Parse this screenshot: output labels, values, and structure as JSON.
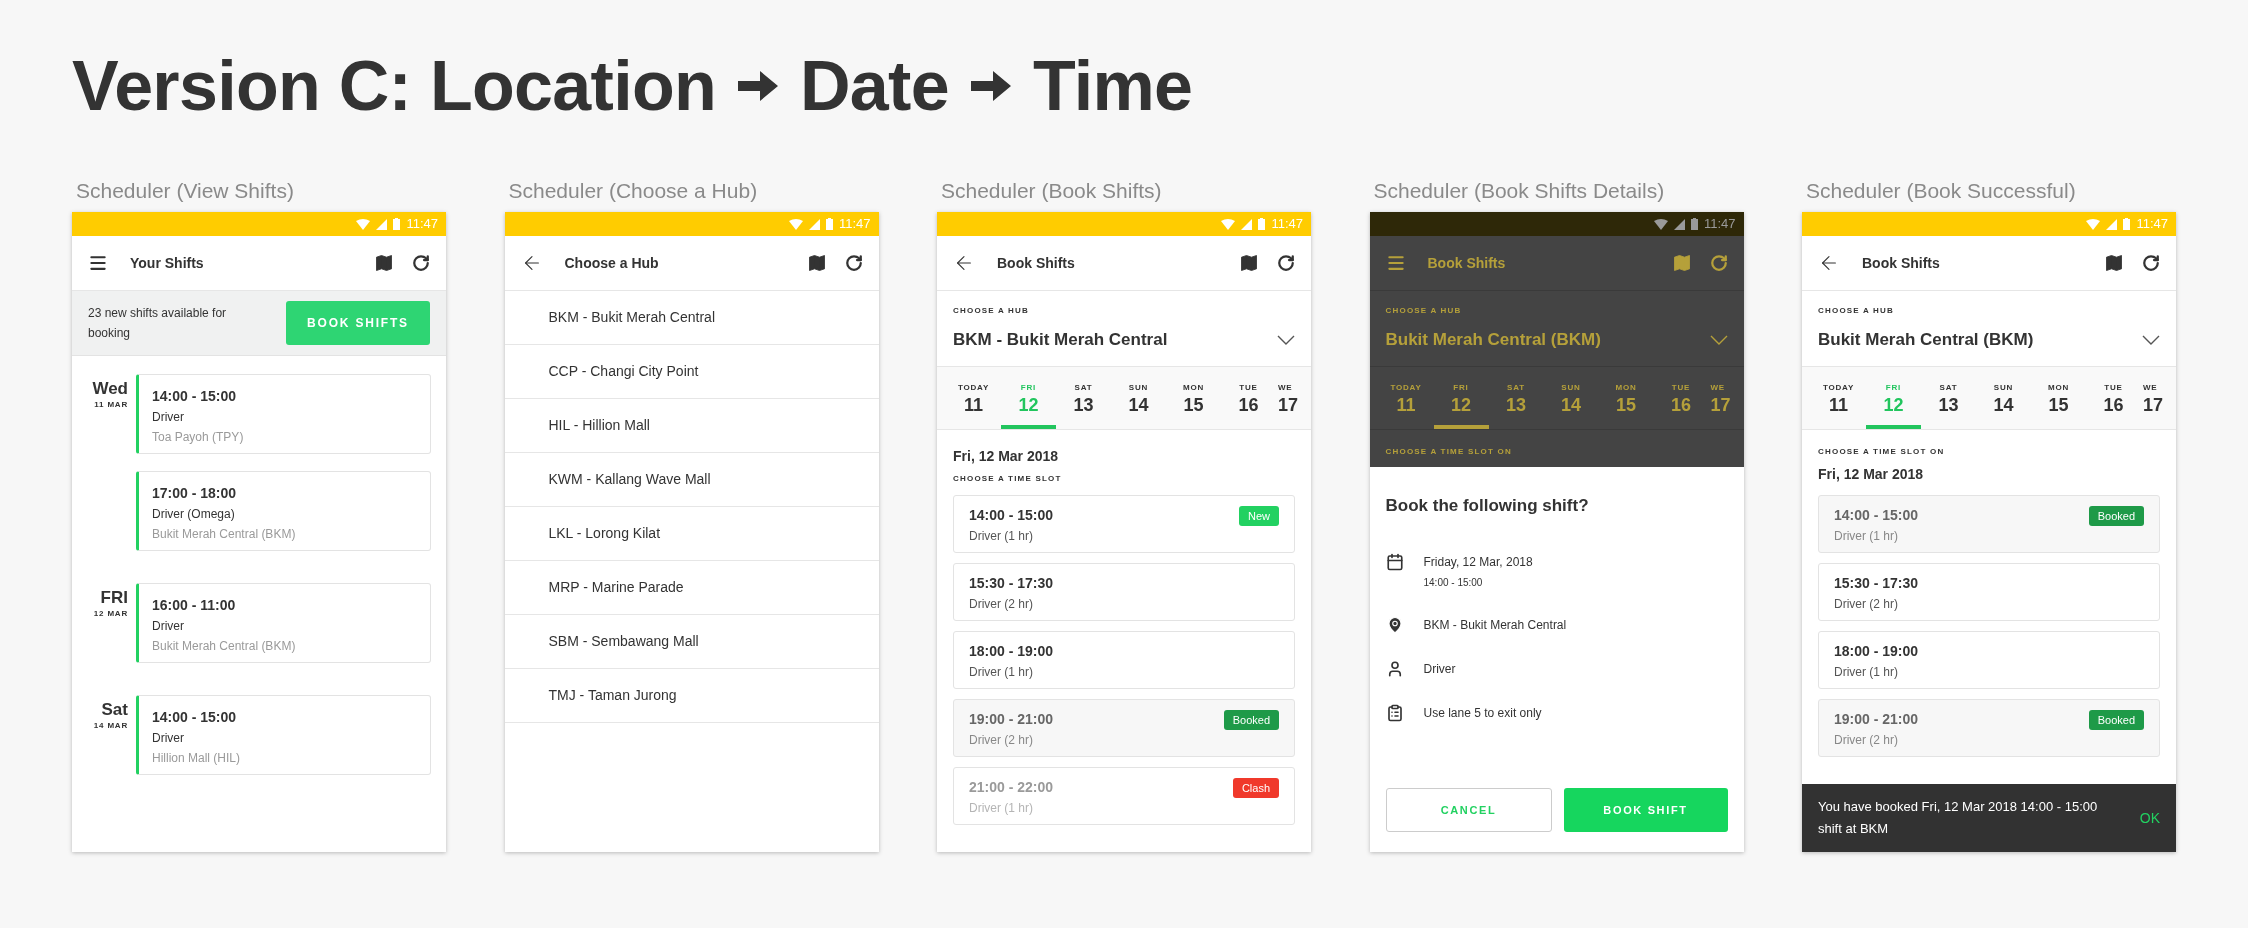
{
  "title": {
    "parts": [
      "Version C: Location",
      "Date",
      "Time"
    ]
  },
  "screens": [
    {
      "kind": "view_shifts",
      "caption": "Scheduler (View Shifts)",
      "status_time": "11:47",
      "dimmed": false,
      "app_bar": {
        "kind": "menu",
        "title": "Your Shifts"
      },
      "banner": {
        "text": "23 new shifts available for booking",
        "button": "BOOK SHIFTS"
      },
      "days": [
        {
          "day": "Wed",
          "date": "11 MAR",
          "shifts": [
            {
              "time": "14:00 - 15:00",
              "role": "Driver",
              "location": "Toa Payoh (TPY)"
            },
            {
              "time": "17:00 - 18:00",
              "role": "Driver (Omega)",
              "location": "Bukit Merah Central (BKM)"
            }
          ]
        },
        {
          "day": "FRI",
          "date": "12 MAR",
          "shifts": [
            {
              "time": "16:00 - 11:00",
              "role": "Driver",
              "location": "Bukit Merah Central (BKM)"
            }
          ]
        },
        {
          "day": "Sat",
          "date": "14 MAR",
          "shifts": [
            {
              "time": "14:00 - 15:00",
              "role": "Driver",
              "location": "Hillion Mall (HIL)"
            }
          ]
        }
      ]
    },
    {
      "kind": "hub_list",
      "caption": "Scheduler (Choose a Hub)",
      "status_time": "11:47",
      "dimmed": false,
      "app_bar": {
        "kind": "back",
        "title": "Choose a Hub"
      },
      "hubs": [
        "BKM - Bukit Merah Central",
        "CCP - Changi City Point",
        "HIL - Hillion Mall",
        "KWM - Kallang Wave Mall",
        "LKL - Lorong Kilat",
        "MRP - Marine Parade",
        "SBM - Sembawang Mall",
        "TMJ - Taman Jurong"
      ]
    },
    {
      "kind": "book",
      "caption": "Scheduler (Book Shifts)",
      "status_time": "11:47",
      "dimmed": false,
      "app_bar": {
        "kind": "back",
        "title": "Book Shifts"
      },
      "hub_label": "CHOOSE A HUB",
      "hub": "BKM - Bukit Merah Central",
      "dates": [
        {
          "weekday": "TODAY",
          "day": "11",
          "selected": false
        },
        {
          "weekday": "FRI",
          "day": "12",
          "selected": true
        },
        {
          "weekday": "SAT",
          "day": "13",
          "selected": false
        },
        {
          "weekday": "SUN",
          "day": "14",
          "selected": false
        },
        {
          "weekday": "MON",
          "day": "15",
          "selected": false
        },
        {
          "weekday": "TUE",
          "day": "16",
          "selected": false
        },
        {
          "weekday": "WE",
          "day": "17",
          "selected": false
        }
      ],
      "slot_header": [
        {
          "kind": "date",
          "text": "Fri, 12 Mar 2018"
        },
        {
          "kind": "label",
          "text": "CHOOSE A TIME SLOT"
        }
      ],
      "slots": [
        {
          "time": "14:00 - 15:00",
          "role": "Driver (1 hr)",
          "kind": "open",
          "badge": {
            "text": "New",
            "kind": "new"
          }
        },
        {
          "time": "15:30 - 17:30",
          "role": "Driver (2 hr)",
          "kind": "open"
        },
        {
          "time": "18:00 - 19:00",
          "role": "Driver (1 hr)",
          "kind": "open"
        },
        {
          "time": "19:00 - 21:00",
          "role": "Driver (2 hr)",
          "kind": "booked",
          "badge": {
            "text": "Booked",
            "kind": "booked"
          }
        },
        {
          "time": "21:00 - 22:00",
          "role": "Driver (1 hr)",
          "kind": "clash",
          "badge": {
            "text": "Clash",
            "kind": "clash"
          }
        }
      ]
    },
    {
      "kind": "book",
      "caption": "Scheduler (Book Shifts Details)",
      "status_time": "11:47",
      "dimmed": true,
      "app_bar": {
        "kind": "menu",
        "title": "Book Shifts"
      },
      "hub_label": "CHOOSE A HUB",
      "hub": "Bukit Merah Central (BKM)",
      "dates": [
        {
          "weekday": "TODAY",
          "day": "11",
          "selected": false
        },
        {
          "weekday": "FRI",
          "day": "12",
          "selected": true
        },
        {
          "weekday": "SAT",
          "day": "13",
          "selected": false
        },
        {
          "weekday": "SUN",
          "day": "14",
          "selected": false
        },
        {
          "weekday": "MON",
          "day": "15",
          "selected": false
        },
        {
          "weekday": "TUE",
          "day": "16",
          "selected": false
        },
        {
          "weekday": "WE",
          "day": "17",
          "selected": false
        }
      ],
      "slot_header": [
        {
          "kind": "label",
          "text": "CHOOSE A TIME SLOT ON"
        }
      ],
      "dialog": {
        "title": "Book the following shift?",
        "details": [
          {
            "kind": "calendar",
            "text": "Friday, 12 Mar, 2018",
            "subtext": "14:00 - 15:00"
          },
          {
            "kind": "pin",
            "text": "BKM - Bukit Merah Central"
          },
          {
            "kind": "person",
            "text": "Driver"
          },
          {
            "kind": "clipboard",
            "text": "Use lane 5 to exit only"
          }
        ],
        "cancel": "CANCEL",
        "confirm": "BOOK SHIFT"
      }
    },
    {
      "kind": "book",
      "caption": "Scheduler (Book Successful)",
      "status_time": "11:47",
      "dimmed": false,
      "app_bar": {
        "kind": "back",
        "title": "Book Shifts"
      },
      "hub_label": "CHOOSE A HUB",
      "hub": "Bukit Merah Central (BKM)",
      "dates": [
        {
          "weekday": "TODAY",
          "day": "11",
          "selected": false
        },
        {
          "weekday": "FRI",
          "day": "12",
          "selected": true
        },
        {
          "weekday": "SAT",
          "day": "13",
          "selected": false
        },
        {
          "weekday": "SUN",
          "day": "14",
          "selected": false
        },
        {
          "weekday": "MON",
          "day": "15",
          "selected": false
        },
        {
          "weekday": "TUE",
          "day": "16",
          "selected": false
        },
        {
          "weekday": "WE",
          "day": "17",
          "selected": false
        }
      ],
      "slot_header": [
        {
          "kind": "label",
          "text": "CHOOSE A TIME SLOT ON"
        },
        {
          "kind": "date",
          "text": "Fri, 12 Mar 2018"
        }
      ],
      "slots": [
        {
          "time": "14:00 - 15:00",
          "role": "Driver (1 hr)",
          "kind": "booked",
          "badge": {
            "text": "Booked",
            "kind": "booked"
          }
        },
        {
          "time": "15:30 - 17:30",
          "role": "Driver (2 hr)",
          "kind": "open"
        },
        {
          "time": "18:00 - 19:00",
          "role": "Driver (1 hr)",
          "kind": "open"
        },
        {
          "time": "19:00 - 21:00",
          "role": "Driver (2 hr)",
          "kind": "booked",
          "badge": {
            "text": "Booked",
            "kind": "booked"
          }
        }
      ],
      "snackbar": {
        "text": "You have booked Fri, 12 Mar 2018 14:00 - 15:00 shift at BKM",
        "action": "OK"
      }
    }
  ]
}
